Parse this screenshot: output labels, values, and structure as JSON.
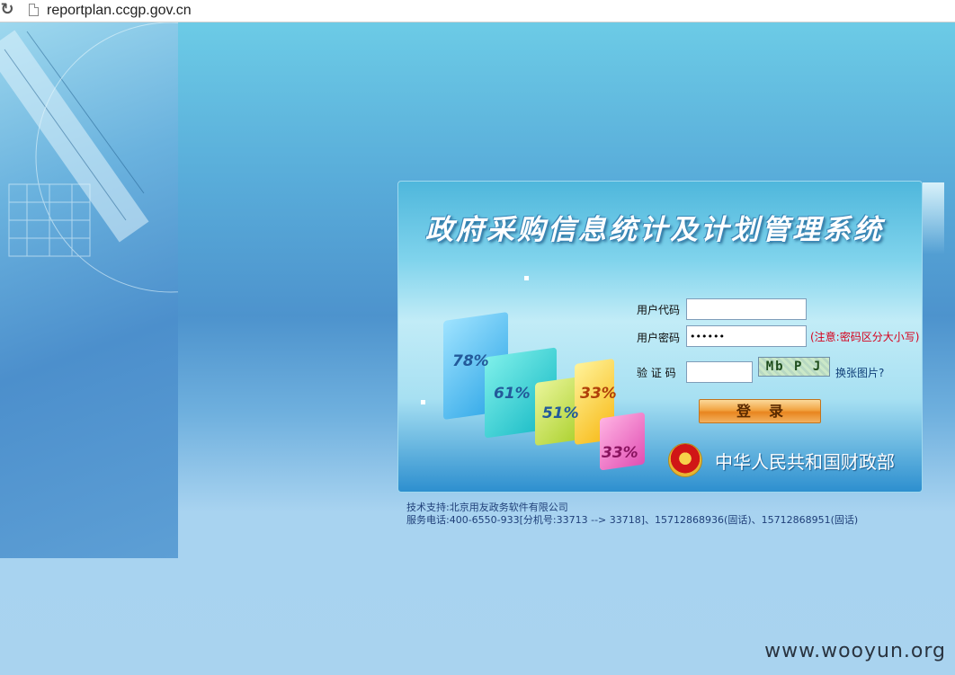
{
  "browser": {
    "url": "reportplan.ccgp.gov.cn"
  },
  "login": {
    "title": "政府采购信息统计及计划管理系统",
    "user_label": "用户代码",
    "password_label": "用户密码",
    "password_value": "••••••",
    "password_note": "(注意:密码区分大小写)",
    "captcha_label": "验 证 码",
    "captcha_text": "Mb P J",
    "refresh_link": "换张图片?",
    "submit_label": "登录",
    "ministry": "中华人民共和国财政部"
  },
  "chart_artwork": {
    "labels": [
      "78%",
      "61%",
      "51%",
      "33%",
      "33%"
    ]
  },
  "footer": {
    "line1": "技术支持:北京用友政务软件有限公司",
    "line2": "服务电话:400-6550-933[分机号:33713 --> 33718]、15712868936(固话)、15712868951(固话)"
  },
  "watermark": "www.wooyun.org",
  "colors": {
    "accent": "#4d93cd",
    "note_red": "#d6001c",
    "button_orange": "#e8851f"
  }
}
